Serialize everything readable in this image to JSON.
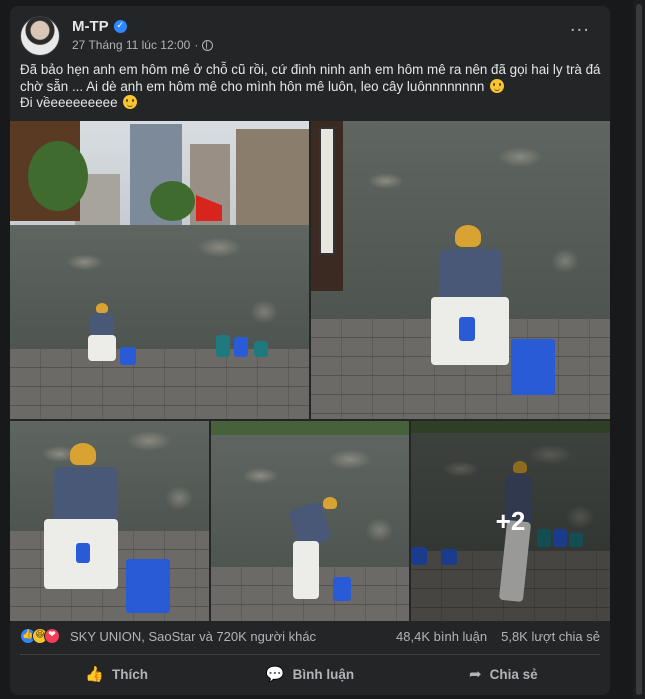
{
  "post": {
    "author": "M-TP",
    "timestamp": "27 Tháng 11 lúc 12:00",
    "privacy_separator": "·",
    "more_label": "···",
    "text_lines": [
      "Đã bảo hẹn anh em hôm mê ở chỗ cũ rồi, cứ đinh ninh anh em hôm mê ra nên đã gọi hai ly trà đá",
      "chờ sẵn ... Ai dè anh em hôm mê cho mình hôn mê luôn, leo cây luônnnnnnnn",
      "Đi vềeeeeeeeee"
    ],
    "photos_more_count": "+2"
  },
  "reactions": {
    "icons": [
      "like-icon",
      "haha-icon",
      "love-icon"
    ],
    "like_glyph": "👍",
    "haha_glyph": "😆",
    "love_glyph": "❤",
    "reactors_text": "SKY UNION, SaoStar và 720K người khác",
    "comments_count": "48,4K bình luận",
    "shares_count": "5,8K lượt chia sẻ"
  },
  "actions": {
    "like_label": "Thích",
    "comment_label": "Bình luận",
    "share_label": "Chia sẻ"
  },
  "colors": {
    "background": "#18191a",
    "card": "#242526",
    "accent": "#2d88ff",
    "text_primary": "#e4e6eb",
    "text_secondary": "#b0b3b8"
  }
}
